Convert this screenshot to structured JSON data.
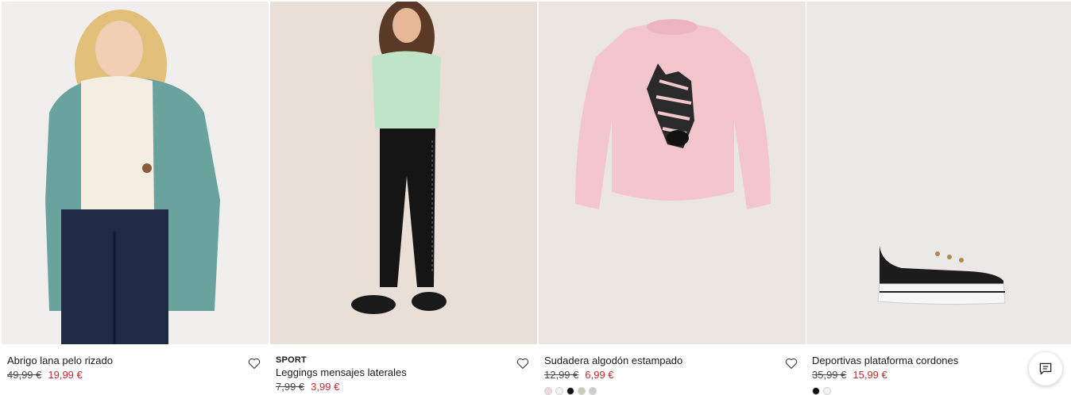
{
  "products": [
    {
      "tag": "",
      "name": "Abrigo lana pelo rizado",
      "old_price": "49,99 €",
      "new_price": "19,99 €",
      "swatches": []
    },
    {
      "tag": "SPORT",
      "name": "Leggings mensajes laterales",
      "old_price": "7,99 €",
      "new_price": "3,99 €",
      "swatches": []
    },
    {
      "tag": "",
      "name": "Sudadera algodón estampado",
      "old_price": "12,99 €",
      "new_price": "6,99 €",
      "swatches": [
        "#f3d6dc",
        "#f2f2f2",
        "#111111",
        "#c9cbb8",
        "#c9cfc9"
      ]
    },
    {
      "tag": "",
      "name": "Deportivas plataforma cordones",
      "old_price": "35,99 €",
      "new_price": "15,99 €",
      "swatches": [
        "#111111",
        "#f2f2f2"
      ]
    }
  ],
  "icons": {
    "favorite": "heart-icon",
    "chat": "chat-icon"
  },
  "colors": {
    "sale_price": "#c8262f",
    "photo_bg_1": "#f1efed",
    "photo_bg_2": "#eadfd6",
    "photo_bg_3": "#ece6e3",
    "photo_bg_4": "#eae9e7"
  }
}
